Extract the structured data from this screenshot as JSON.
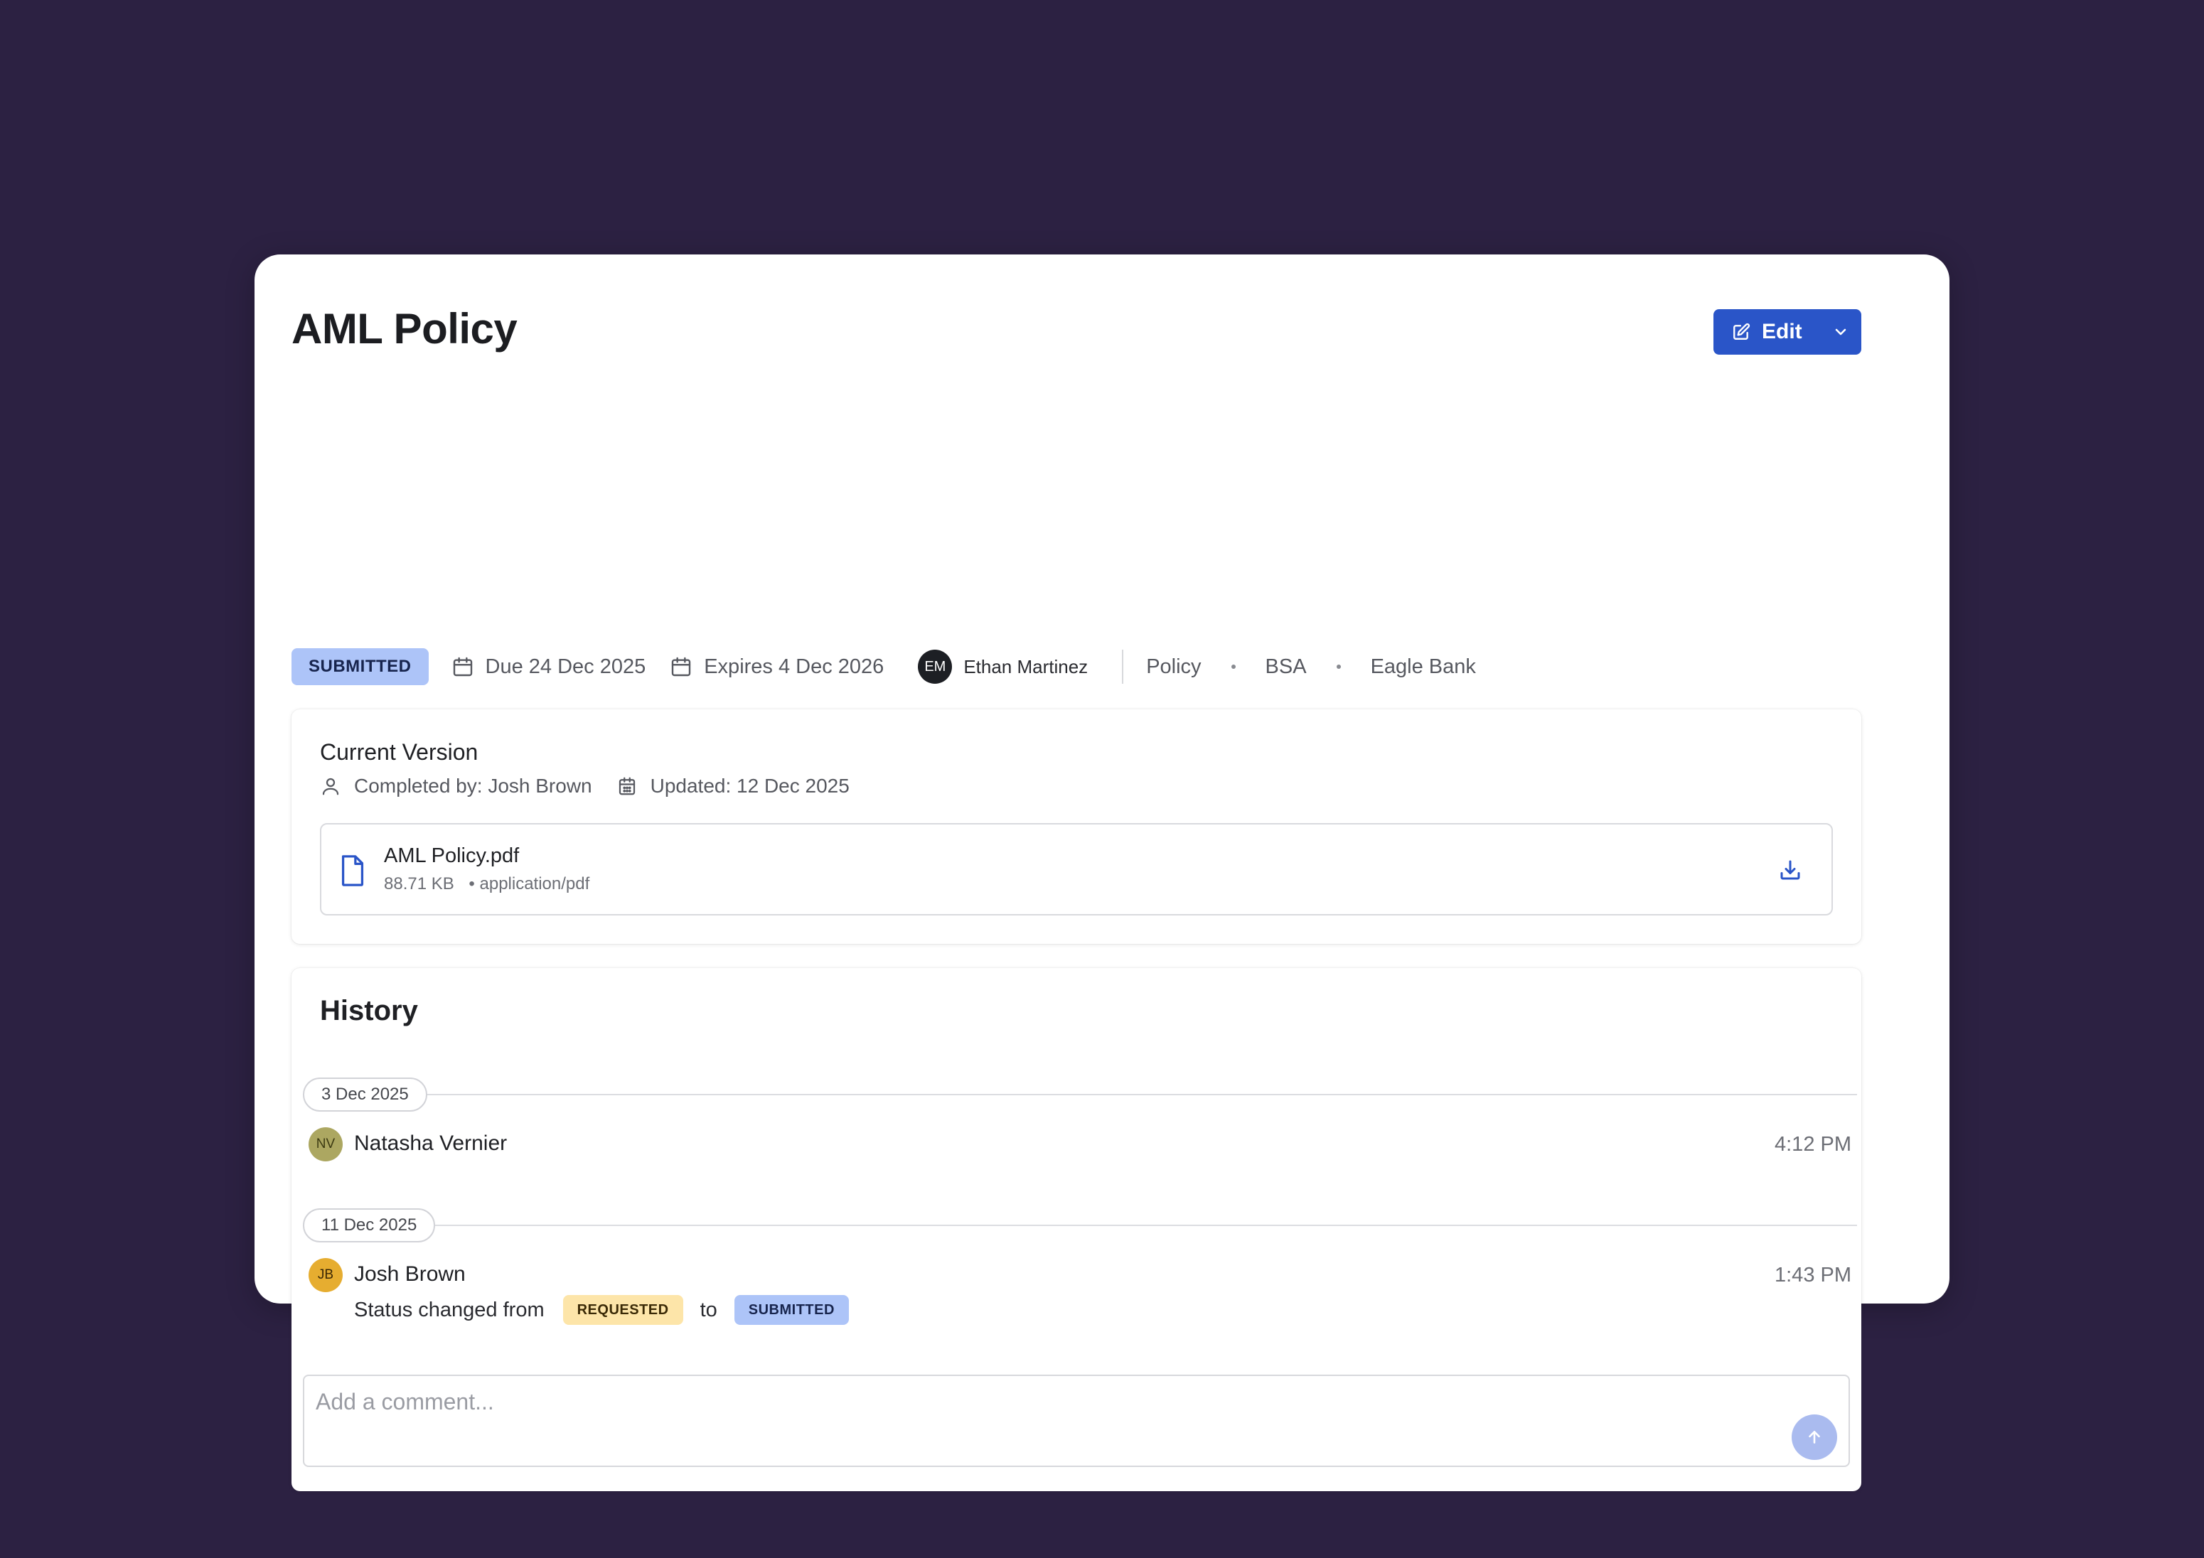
{
  "header": {
    "title": "AML Policy",
    "edit_label": "Edit"
  },
  "meta": {
    "status": "SUBMITTED",
    "due": "Due 24 Dec 2025",
    "expires": "Expires 4 Dec 2026",
    "owner_initials": "EM",
    "owner_name": "Ethan Martinez",
    "tags": [
      "Policy",
      "BSA",
      "Eagle Bank"
    ]
  },
  "current_version": {
    "title": "Current Version",
    "completed_by": "Completed by: Josh Brown",
    "updated": "Updated: 12 Dec 2025",
    "file": {
      "name": "AML Policy.pdf",
      "size": "88.71 KB",
      "type": "• application/pdf"
    }
  },
  "history": {
    "title": "History",
    "groups": [
      {
        "date": "3 Dec 2025",
        "entries": [
          {
            "initials": "NV",
            "name": "Natasha Vernier",
            "time": "4:12 PM"
          }
        ]
      },
      {
        "date": "11 Dec 2025",
        "entries": [
          {
            "initials": "JB",
            "name": "Josh Brown",
            "time": "1:43 PM",
            "desc_prefix": "Status changed from",
            "from_status": "REQUESTED",
            "connector": "to",
            "to_status": "SUBMITTED"
          }
        ]
      }
    ],
    "comment_placeholder": "Add a comment..."
  },
  "colors": {
    "background": "#2c2142",
    "accent": "#2a55c8",
    "submitted_badge": "#adc4f8",
    "requested_badge": "#fde5a9"
  },
  "icons": [
    "edit-icon",
    "chevron-down-icon",
    "calendar-icon",
    "user-icon",
    "calendar-grid-icon",
    "file-icon",
    "download-icon",
    "arrow-up-icon"
  ]
}
